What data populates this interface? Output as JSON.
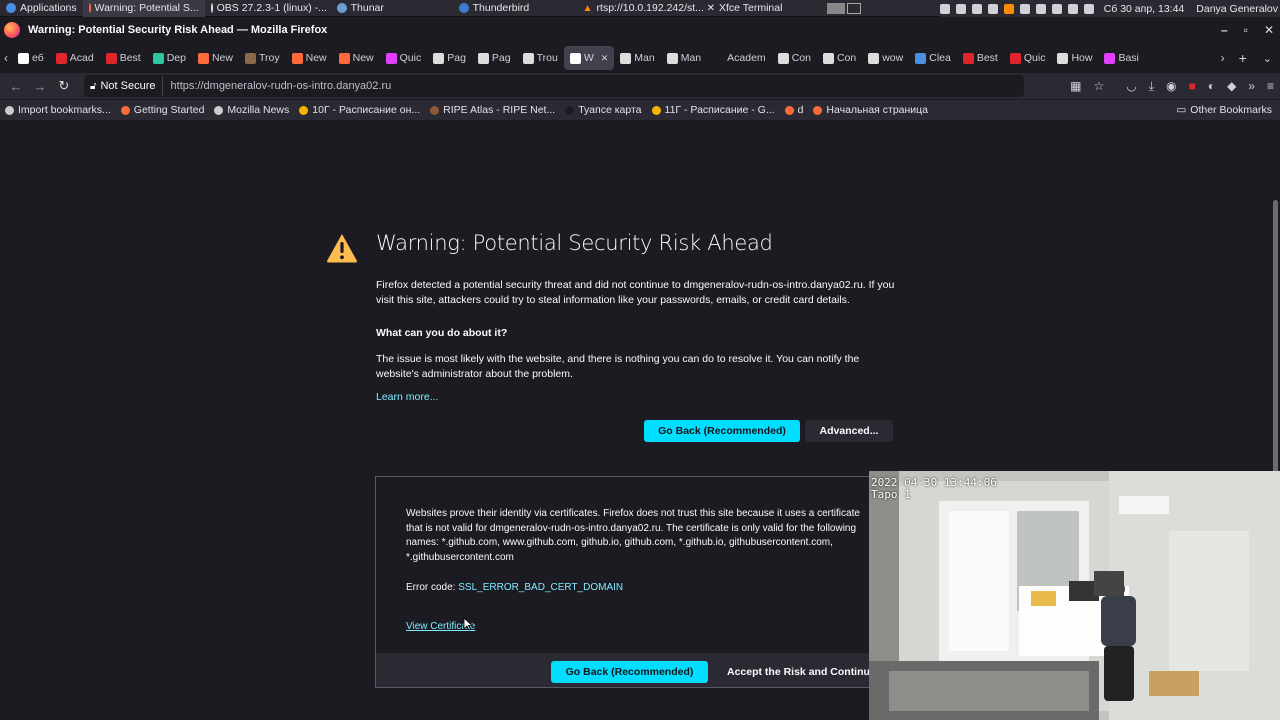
{
  "panel": {
    "applications": "Applications",
    "tasks": [
      {
        "label": "Warning: Potential S..."
      },
      {
        "label": "OBS 27.2.3-1 (linux) -..."
      },
      {
        "label": "Thunar"
      },
      {
        "label": "Thunderbird"
      },
      {
        "label": "rtsp://10.0.192.242/st..."
      },
      {
        "label": "Xfce Terminal"
      }
    ],
    "clock": "Сб 30 апр, 13:44",
    "user": "Danya Generalov"
  },
  "window": {
    "title": "Warning: Potential Security Risk Ahead — Mozilla Firefox"
  },
  "tabs": [
    {
      "label": "еб",
      "icon_color": "#ffffff"
    },
    {
      "label": "Acad",
      "icon_color": "#e0262c"
    },
    {
      "label": "Best",
      "icon_color": "#e0262c"
    },
    {
      "label": "Dep",
      "icon_color": "#2ec6a0"
    },
    {
      "label": "New",
      "icon_color": "#ff6a3a"
    },
    {
      "label": "Troy",
      "icon_color": "#8a6a4a"
    },
    {
      "label": "New",
      "icon_color": "#ff6a3a"
    },
    {
      "label": "New",
      "icon_color": "#ff6a3a"
    },
    {
      "label": "Quic",
      "icon_color": "#e040fb"
    },
    {
      "label": "Pag",
      "icon_color": "#dddddd"
    },
    {
      "label": "Pag",
      "icon_color": "#dddddd"
    },
    {
      "label": "Trou",
      "icon_color": "#dddddd"
    },
    {
      "label": "W",
      "icon_color": "#ffffff",
      "active": true
    },
    {
      "label": "Man",
      "icon_color": "#dddddd"
    },
    {
      "label": "Man",
      "icon_color": "#dddddd"
    },
    {
      "label": "Academ",
      "icon_color": "#1c1b22"
    },
    {
      "label": "Con",
      "icon_color": "#dddddd"
    },
    {
      "label": "Con",
      "icon_color": "#dddddd"
    },
    {
      "label": "wow",
      "icon_color": "#dddddd"
    },
    {
      "label": "Clea",
      "icon_color": "#4a90e2"
    },
    {
      "label": "Best",
      "icon_color": "#e0262c"
    },
    {
      "label": "Quic",
      "icon_color": "#e0262c"
    },
    {
      "label": "How",
      "icon_color": "#dddddd"
    },
    {
      "label": "Basi",
      "icon_color": "#e040fb"
    }
  ],
  "nav": {
    "not_secure": "Not Secure",
    "url": "https://dmgeneralov-rudn-os-intro.danya02.ru"
  },
  "bookmarks": [
    {
      "label": "Import bookmarks...",
      "icon_color": "#cccccc"
    },
    {
      "label": "Getting Started",
      "icon_color": "#ff6a3a"
    },
    {
      "label": "Mozilla News",
      "icon_color": "#cccccc"
    },
    {
      "label": "10Г - Расписание он...",
      "icon_color": "#f4b400"
    },
    {
      "label": "RIPE Atlas - RIPE Net...",
      "icon_color": "#8a5a3a"
    },
    {
      "label": "Туапсе карта",
      "icon_color": "#1c1b22"
    },
    {
      "label": "11Г - Расписание - G...",
      "icon_color": "#f4b400"
    },
    {
      "label": "d",
      "icon_color": "#ff6a3a"
    },
    {
      "label": "Начальная страница",
      "icon_color": "#ff6a3a"
    }
  ],
  "other_bookmarks": "Other Bookmarks",
  "page": {
    "title": "Warning: Potential Security Risk Ahead",
    "intro": "Firefox detected a potential security threat and did not continue to dmgeneralov-rudn-os-intro.danya02.ru. If you visit this site, attackers could try to steal information like your passwords, emails, or credit card details.",
    "question": "What can you do about it?",
    "answer": "The issue is most likely with the website, and there is nothing you can do to resolve it. You can notify the website's administrator about the problem.",
    "learn_more": "Learn more...",
    "go_back": "Go Back (Recommended)",
    "advanced": "Advanced...",
    "adv_text": "Websites prove their identity via certificates. Firefox does not trust this site because it uses a certificate that is not valid for dmgeneralov-rudn-os-intro.danya02.ru. The certificate is only valid for the following names: *.github.com, www.github.com, github.io, github.com, *.github.io, githubusercontent.com, *.githubusercontent.com",
    "error_code_label": "Error code:",
    "error_code": "SSL_ERROR_BAD_CERT_DOMAIN",
    "view_certificate": "View Certificate",
    "go_back_2": "Go Back (Recommended)",
    "accept_risk": "Accept the Risk and Continue"
  },
  "camera": {
    "timestamp": "2022-04-30  13:44:06",
    "label": "Тapo 1"
  },
  "colors": {
    "accent": "#00ddff",
    "link": "#80ebff",
    "warning": "#ffbd4f",
    "background": "#1c1b22"
  }
}
